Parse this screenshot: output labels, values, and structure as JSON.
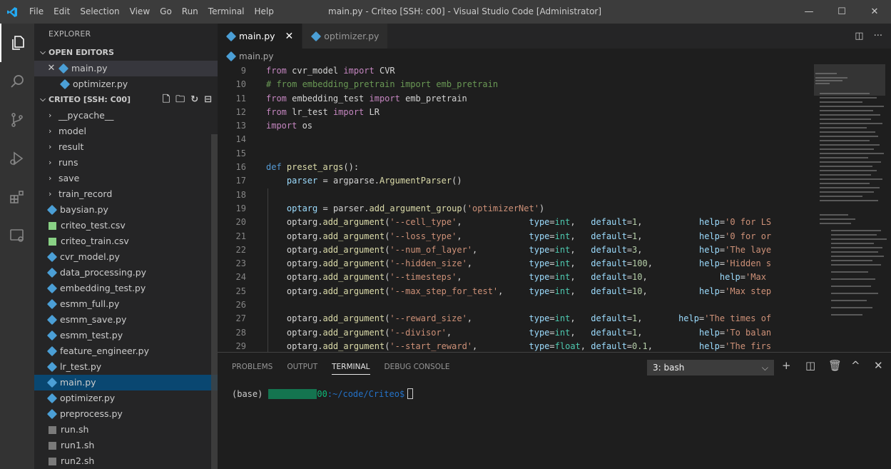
{
  "window": {
    "title": "main.py - Criteo [SSH: c00] - Visual Studio Code [Administrator]",
    "menu": [
      "File",
      "Edit",
      "Selection",
      "View",
      "Go",
      "Run",
      "Terminal",
      "Help"
    ]
  },
  "activity_bar": {
    "icons": [
      "explorer-icon",
      "search-icon",
      "source-control-icon",
      "run-debug-icon",
      "extensions-icon",
      "remote-explorer-icon"
    ]
  },
  "sidebar": {
    "title": "EXPLORER",
    "open_editors_label": "OPEN EDITORS",
    "open_editors": [
      {
        "name": "main.py",
        "has_close": true
      },
      {
        "name": "optimizer.py",
        "has_close": false
      }
    ],
    "workspace_label": "CRITEO [SSH: C00]",
    "folders": [
      "__pycache__",
      "model",
      "result",
      "runs",
      "save",
      "train_record"
    ],
    "files": [
      {
        "name": "baysian.py",
        "type": "py"
      },
      {
        "name": "criteo_test.csv",
        "type": "csv"
      },
      {
        "name": "criteo_train.csv",
        "type": "csv"
      },
      {
        "name": "cvr_model.py",
        "type": "py"
      },
      {
        "name": "data_processing.py",
        "type": "py"
      },
      {
        "name": "embedding_test.py",
        "type": "py"
      },
      {
        "name": "esmm_full.py",
        "type": "py"
      },
      {
        "name": "esmm_save.py",
        "type": "py"
      },
      {
        "name": "esmm_test.py",
        "type": "py"
      },
      {
        "name": "feature_engineer.py",
        "type": "py"
      },
      {
        "name": "lr_test.py",
        "type": "py"
      },
      {
        "name": "main.py",
        "type": "py"
      },
      {
        "name": "optimizer.py",
        "type": "py"
      },
      {
        "name": "preprocess.py",
        "type": "py"
      },
      {
        "name": "run.sh",
        "type": "sh"
      },
      {
        "name": "run1.sh",
        "type": "sh"
      },
      {
        "name": "run2.sh",
        "type": "sh"
      }
    ],
    "active_file": "main.py"
  },
  "tabs": [
    {
      "label": "main.py",
      "active": true
    },
    {
      "label": "optimizer.py",
      "active": false
    }
  ],
  "breadcrumb": "main.py",
  "code": [
    {
      "n": "9",
      "t": [
        [
          "kw-c",
          "from"
        ],
        [
          "",
          " cvr_model "
        ],
        [
          "kw-c",
          "import"
        ],
        [
          "",
          " CVR"
        ]
      ]
    },
    {
      "n": "10",
      "t": [
        [
          "cm",
          "# from embedding_pretrain import emb_pretrain"
        ]
      ]
    },
    {
      "n": "11",
      "t": [
        [
          "kw-c",
          "from"
        ],
        [
          "",
          " embedding_test "
        ],
        [
          "kw-c",
          "import"
        ],
        [
          "",
          " emb_pretrain"
        ]
      ]
    },
    {
      "n": "12",
      "t": [
        [
          "kw-c",
          "from"
        ],
        [
          "",
          " lr_test "
        ],
        [
          "kw-c",
          "import"
        ],
        [
          "",
          " LR"
        ]
      ]
    },
    {
      "n": "13",
      "t": [
        [
          "kw-c",
          "import"
        ],
        [
          "",
          " os"
        ]
      ]
    },
    {
      "n": "14",
      "t": []
    },
    {
      "n": "15",
      "t": []
    },
    {
      "n": "16",
      "t": [
        [
          "kw-b",
          "def"
        ],
        [
          "",
          " "
        ],
        [
          "fn",
          "preset_args"
        ],
        [
          "",
          "():"
        ]
      ]
    },
    {
      "n": "17",
      "t": [
        [
          "",
          "    "
        ],
        [
          "var",
          "parser"
        ],
        [
          "",
          " = argparse."
        ],
        [
          "fn",
          "ArgumentParser"
        ],
        [
          "",
          "()"
        ]
      ]
    },
    {
      "n": "18",
      "t": []
    },
    {
      "n": "19",
      "t": [
        [
          "",
          "    "
        ],
        [
          "var",
          "optarg"
        ],
        [
          "",
          " = parser."
        ],
        [
          "fn",
          "add_argument_group"
        ],
        [
          "",
          "("
        ],
        [
          "str",
          "'optimizerNet'"
        ],
        [
          "",
          ")"
        ]
      ]
    },
    {
      "n": "20",
      "t": [
        [
          "",
          "    optarg."
        ],
        [
          "fn",
          "add_argument"
        ],
        [
          "",
          "("
        ],
        [
          "str",
          "'--cell_type'"
        ],
        [
          "",
          ",             "
        ],
        [
          "var",
          "type"
        ],
        [
          "",
          "="
        ],
        [
          "cls",
          "int"
        ],
        [
          "",
          ",   "
        ],
        [
          "var",
          "default"
        ],
        [
          "",
          "="
        ],
        [
          "num",
          "1"
        ],
        [
          "",
          ",           "
        ],
        [
          "var",
          "help"
        ],
        [
          "",
          "="
        ],
        [
          "str",
          "'0 for LS"
        ]
      ]
    },
    {
      "n": "21",
      "t": [
        [
          "",
          "    optarg."
        ],
        [
          "fn",
          "add_argument"
        ],
        [
          "",
          "("
        ],
        [
          "str",
          "'--loss_type'"
        ],
        [
          "",
          ",             "
        ],
        [
          "var",
          "type"
        ],
        [
          "",
          "="
        ],
        [
          "cls",
          "int"
        ],
        [
          "",
          ",   "
        ],
        [
          "var",
          "default"
        ],
        [
          "",
          "="
        ],
        [
          "num",
          "1"
        ],
        [
          "",
          ",           "
        ],
        [
          "var",
          "help"
        ],
        [
          "",
          "="
        ],
        [
          "str",
          "'0 for or"
        ]
      ]
    },
    {
      "n": "22",
      "t": [
        [
          "",
          "    optarg."
        ],
        [
          "fn",
          "add_argument"
        ],
        [
          "",
          "("
        ],
        [
          "str",
          "'--num_of_layer'"
        ],
        [
          "",
          ",          "
        ],
        [
          "var",
          "type"
        ],
        [
          "",
          "="
        ],
        [
          "cls",
          "int"
        ],
        [
          "",
          ",   "
        ],
        [
          "var",
          "default"
        ],
        [
          "",
          "="
        ],
        [
          "num",
          "3"
        ],
        [
          "",
          ",           "
        ],
        [
          "var",
          "help"
        ],
        [
          "",
          "="
        ],
        [
          "str",
          "'The laye"
        ]
      ]
    },
    {
      "n": "23",
      "t": [
        [
          "",
          "    optarg."
        ],
        [
          "fn",
          "add_argument"
        ],
        [
          "",
          "("
        ],
        [
          "str",
          "'--hidden_size'"
        ],
        [
          "",
          ",           "
        ],
        [
          "var",
          "type"
        ],
        [
          "",
          "="
        ],
        [
          "cls",
          "int"
        ],
        [
          "",
          ",   "
        ],
        [
          "var",
          "default"
        ],
        [
          "",
          "="
        ],
        [
          "num",
          "100"
        ],
        [
          "",
          ",         "
        ],
        [
          "var",
          "help"
        ],
        [
          "",
          "="
        ],
        [
          "str",
          "'Hidden s"
        ]
      ]
    },
    {
      "n": "24",
      "t": [
        [
          "",
          "    optarg."
        ],
        [
          "fn",
          "add_argument"
        ],
        [
          "",
          "("
        ],
        [
          "str",
          "'--timesteps'"
        ],
        [
          "",
          ",             "
        ],
        [
          "var",
          "type"
        ],
        [
          "",
          "="
        ],
        [
          "cls",
          "int"
        ],
        [
          "",
          ",   "
        ],
        [
          "var",
          "default"
        ],
        [
          "",
          "="
        ],
        [
          "num",
          "10"
        ],
        [
          "",
          ",              "
        ],
        [
          "var",
          "help"
        ],
        [
          "",
          "="
        ],
        [
          "str",
          "'Max"
        ]
      ]
    },
    {
      "n": "25",
      "t": [
        [
          "",
          "    optarg."
        ],
        [
          "fn",
          "add_argument"
        ],
        [
          "",
          "("
        ],
        [
          "str",
          "'--max_step_for_test'"
        ],
        [
          "",
          ",     "
        ],
        [
          "var",
          "type"
        ],
        [
          "",
          "="
        ],
        [
          "cls",
          "int"
        ],
        [
          "",
          ",   "
        ],
        [
          "var",
          "default"
        ],
        [
          "",
          "="
        ],
        [
          "num",
          "10"
        ],
        [
          "",
          ",          "
        ],
        [
          "var",
          "help"
        ],
        [
          "",
          "="
        ],
        [
          "str",
          "'Max step"
        ]
      ]
    },
    {
      "n": "26",
      "t": []
    },
    {
      "n": "27",
      "t": [
        [
          "",
          "    optarg."
        ],
        [
          "fn",
          "add_argument"
        ],
        [
          "",
          "("
        ],
        [
          "str",
          "'--reward_size'"
        ],
        [
          "",
          ",           "
        ],
        [
          "var",
          "type"
        ],
        [
          "",
          "="
        ],
        [
          "cls",
          "int"
        ],
        [
          "",
          ",   "
        ],
        [
          "var",
          "default"
        ],
        [
          "",
          "="
        ],
        [
          "num",
          "1"
        ],
        [
          "",
          ",       "
        ],
        [
          "var",
          "help"
        ],
        [
          "",
          "="
        ],
        [
          "str",
          "'The times of"
        ]
      ]
    },
    {
      "n": "28",
      "t": [
        [
          "",
          "    optarg."
        ],
        [
          "fn",
          "add_argument"
        ],
        [
          "",
          "("
        ],
        [
          "str",
          "'--divisor'"
        ],
        [
          "",
          ",               "
        ],
        [
          "var",
          "type"
        ],
        [
          "",
          "="
        ],
        [
          "cls",
          "int"
        ],
        [
          "",
          ",   "
        ],
        [
          "var",
          "default"
        ],
        [
          "",
          "="
        ],
        [
          "num",
          "1"
        ],
        [
          "",
          ",           "
        ],
        [
          "var",
          "help"
        ],
        [
          "",
          "="
        ],
        [
          "str",
          "'To balan"
        ]
      ]
    },
    {
      "n": "29",
      "t": [
        [
          "",
          "    optarg."
        ],
        [
          "fn",
          "add_argument"
        ],
        [
          "",
          "("
        ],
        [
          "str",
          "'--start_reward'"
        ],
        [
          "",
          ",          "
        ],
        [
          "var",
          "type"
        ],
        [
          "",
          "="
        ],
        [
          "cls",
          "float"
        ],
        [
          "",
          ", "
        ],
        [
          "var",
          "default"
        ],
        [
          "",
          "="
        ],
        [
          "num",
          "0.1"
        ],
        [
          "",
          ",         "
        ],
        [
          "var",
          "help"
        ],
        [
          "",
          "="
        ],
        [
          "str",
          "'The firs"
        ]
      ]
    }
  ],
  "panel": {
    "tabs": [
      {
        "label": "PROBLEMS",
        "active": false
      },
      {
        "label": "OUTPUT",
        "active": false
      },
      {
        "label": "TERMINAL",
        "active": true
      },
      {
        "label": "DEBUG CONSOLE",
        "active": false
      }
    ],
    "terminal_select": "3: bash",
    "prompt_env": "(base)",
    "prompt_host_suffix": "00",
    "prompt_path": ":~/code/Criteo$"
  },
  "colors": {
    "accent": "#007acc",
    "selection": "#094771",
    "python_icon": "#4b9fd6",
    "csv_icon": "#89d185"
  }
}
